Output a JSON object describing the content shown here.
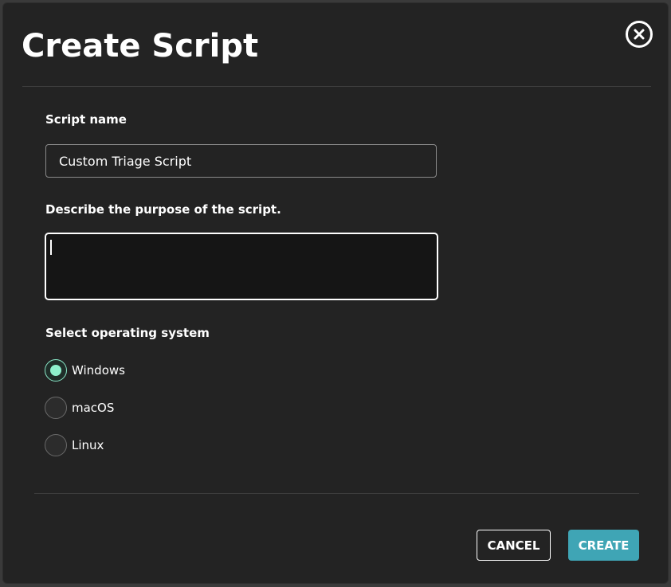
{
  "dialog": {
    "title": "Create Script"
  },
  "form": {
    "script_name": {
      "label": "Script name",
      "value": "Custom Triage Script"
    },
    "purpose": {
      "label": "Describe the purpose of the script.",
      "value": ""
    },
    "os": {
      "label": "Select operating system",
      "options": [
        {
          "label": "Windows",
          "selected": true
        },
        {
          "label": "macOS",
          "selected": false
        },
        {
          "label": "Linux",
          "selected": false
        }
      ]
    }
  },
  "actions": {
    "cancel_label": "CANCEL",
    "create_label": "CREATE"
  },
  "colors": {
    "accent": "#3fa5b5",
    "radio_selected": "#8ef0cc",
    "modal_bg": "#232323"
  },
  "icons": {
    "close": "close-icon"
  }
}
